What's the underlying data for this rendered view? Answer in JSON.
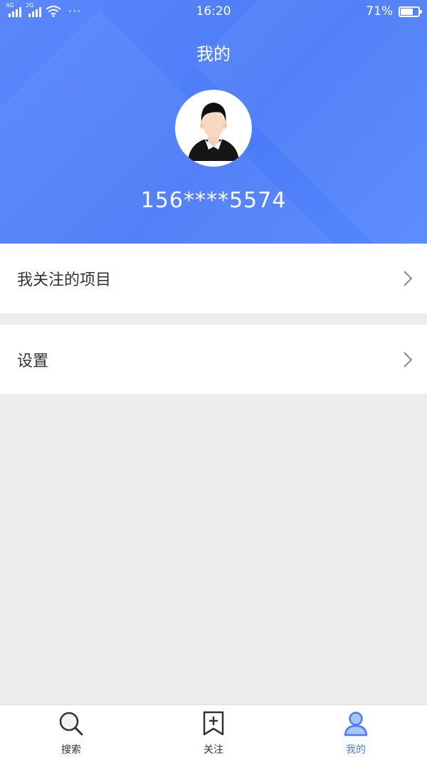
{
  "status_bar": {
    "signal1_tag": "4G",
    "signal2_tag": "2G",
    "more": "···",
    "time": "16:20",
    "battery_text": "71%",
    "battery_level": 0.71
  },
  "header": {
    "title": "我的",
    "phone": "156****5574",
    "avatar_icon": "user-avatar-icon"
  },
  "menu": {
    "follow_label": "我关注的项目",
    "settings_label": "设置"
  },
  "tabbar": {
    "tabs": [
      {
        "label": "搜索",
        "icon": "search-icon"
      },
      {
        "label": "关注",
        "icon": "bookmark-plus-icon"
      },
      {
        "label": "我的",
        "icon": "user-icon"
      }
    ],
    "active_index": 2
  },
  "colors": {
    "header_blue": "#4b7bf8",
    "accent": "#4a7cf5",
    "background": "#ededed",
    "tab_icon": "#333333"
  }
}
